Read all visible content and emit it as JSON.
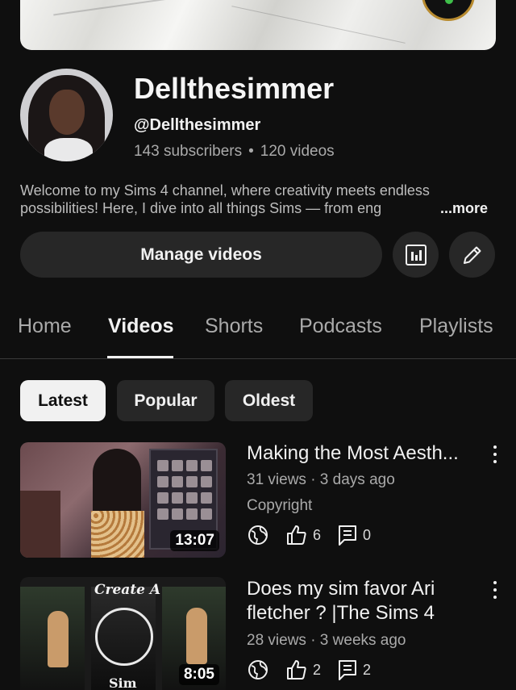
{
  "channel": {
    "name": "Dellthesimmer",
    "handle": "@Dellthesimmer",
    "subscribers": "143 subscribers",
    "separator": "•",
    "videos_count": "120 videos",
    "description_line1": "Welcome to my Sims 4 channel, where creativity meets endless",
    "description_line2": "possibilities! Here, I dive into all things Sims — from eng",
    "more_label": "...more"
  },
  "actions": {
    "manage_videos": "Manage videos",
    "analytics_icon": "bar-chart-icon",
    "edit_icon": "pencil-icon"
  },
  "tabs": [
    {
      "label": "Home",
      "active": false
    },
    {
      "label": "Videos",
      "active": true
    },
    {
      "label": "Shorts",
      "active": false
    },
    {
      "label": "Podcasts",
      "active": false
    },
    {
      "label": "Playlists",
      "active": false
    }
  ],
  "filters": [
    {
      "label": "Latest",
      "selected": true
    },
    {
      "label": "Popular",
      "selected": false
    },
    {
      "label": "Oldest",
      "selected": false
    }
  ],
  "videos": [
    {
      "title": "Making the Most Aesth...",
      "meta": "31 views · 3 days ago",
      "notice": "Copyright",
      "duration": "13:07",
      "likes": "6",
      "comments": "0",
      "visibility_icon": "globe-icon"
    },
    {
      "title": "Does my sim favor Ari fletcher ? |The Sims 4",
      "meta": "28 views · 3 weeks ago",
      "duration": "8:05",
      "likes": "2",
      "comments": "2",
      "visibility_icon": "globe-icon",
      "thumb_text_top": "Create A",
      "thumb_text_bottom": "Sim"
    }
  ],
  "colors": {
    "background": "#0f0f0f",
    "surface": "#272727",
    "text_primary": "#f1f1f1",
    "text_secondary": "#aaaaaa",
    "chip_selected_bg": "#f1f1f1"
  }
}
